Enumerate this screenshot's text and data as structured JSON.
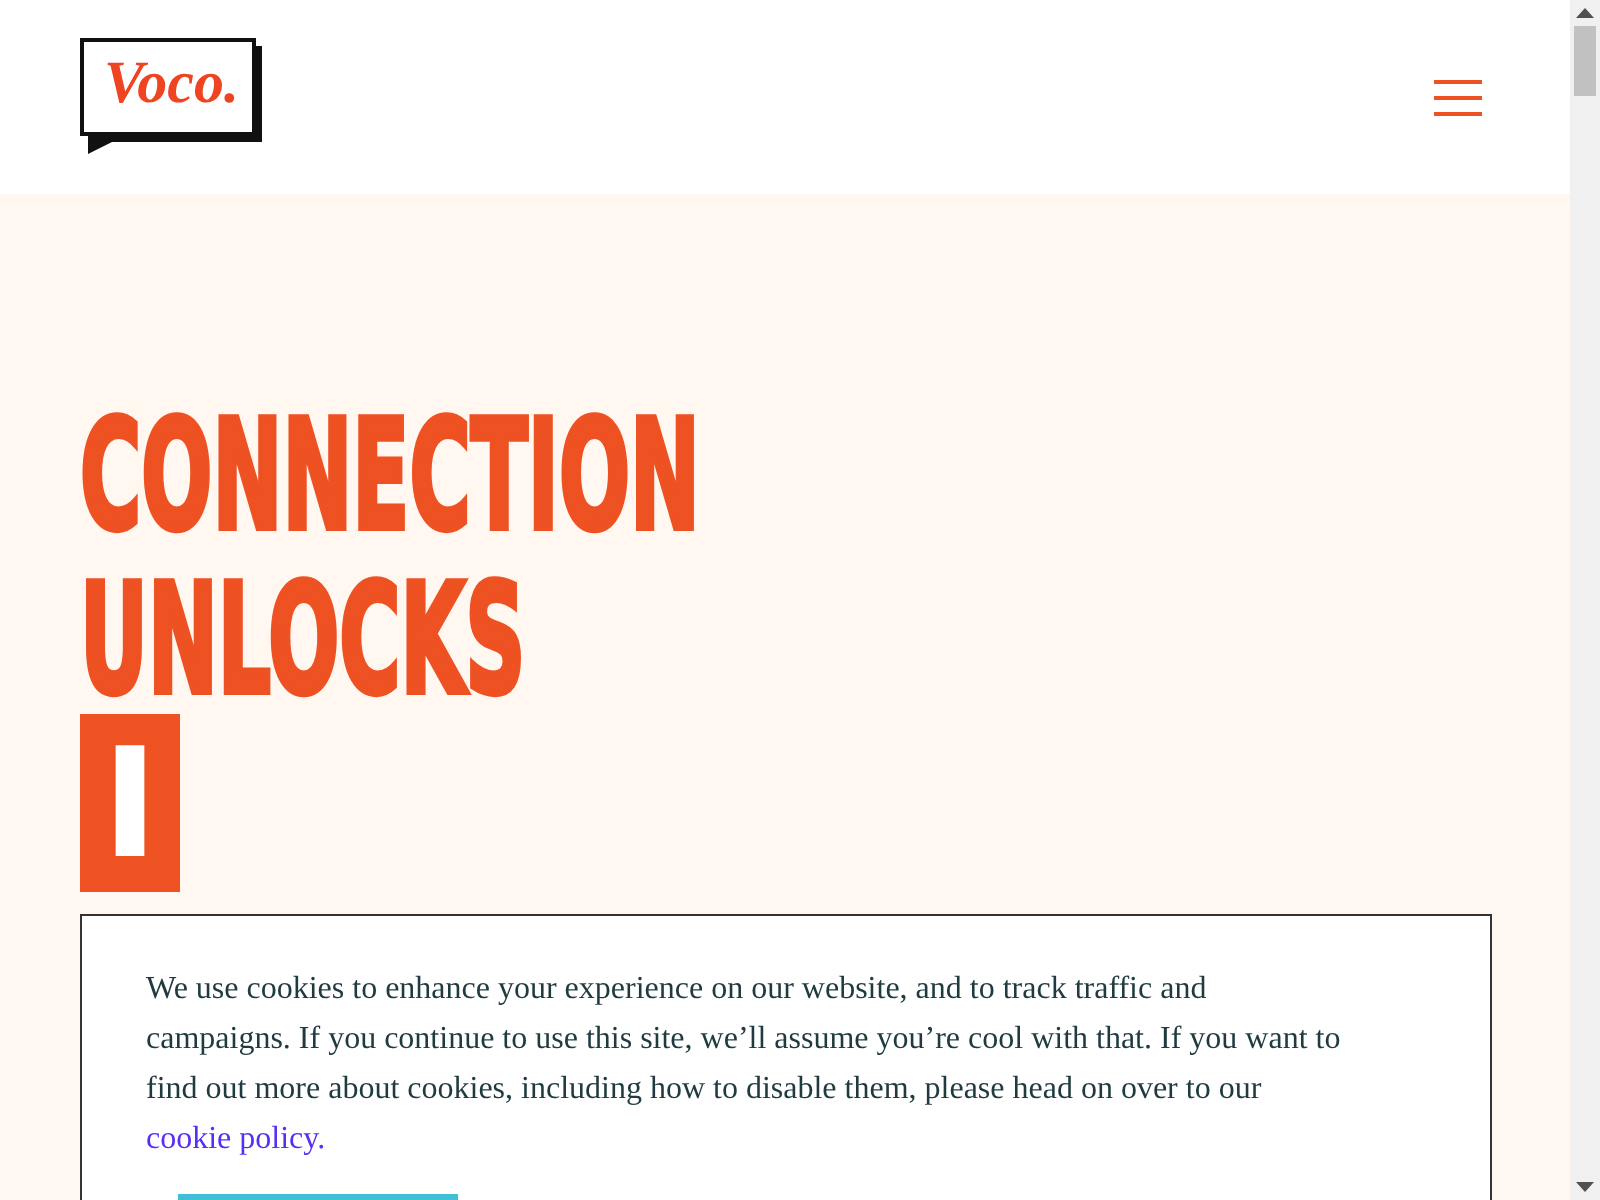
{
  "header": {
    "logo_text": "Voco."
  },
  "hero": {
    "headline": "CONNECTION UNLOCKS",
    "typed_text": "I"
  },
  "cookie_banner": {
    "message": "We use cookies to enhance your experience on our website, and to track traffic and campaigns. If you continue to use this site, we’ll assume you’re cool with that. If you want to find out more about cookies, including how to disable them, please head on over to our ",
    "link": "cookie policy."
  }
}
